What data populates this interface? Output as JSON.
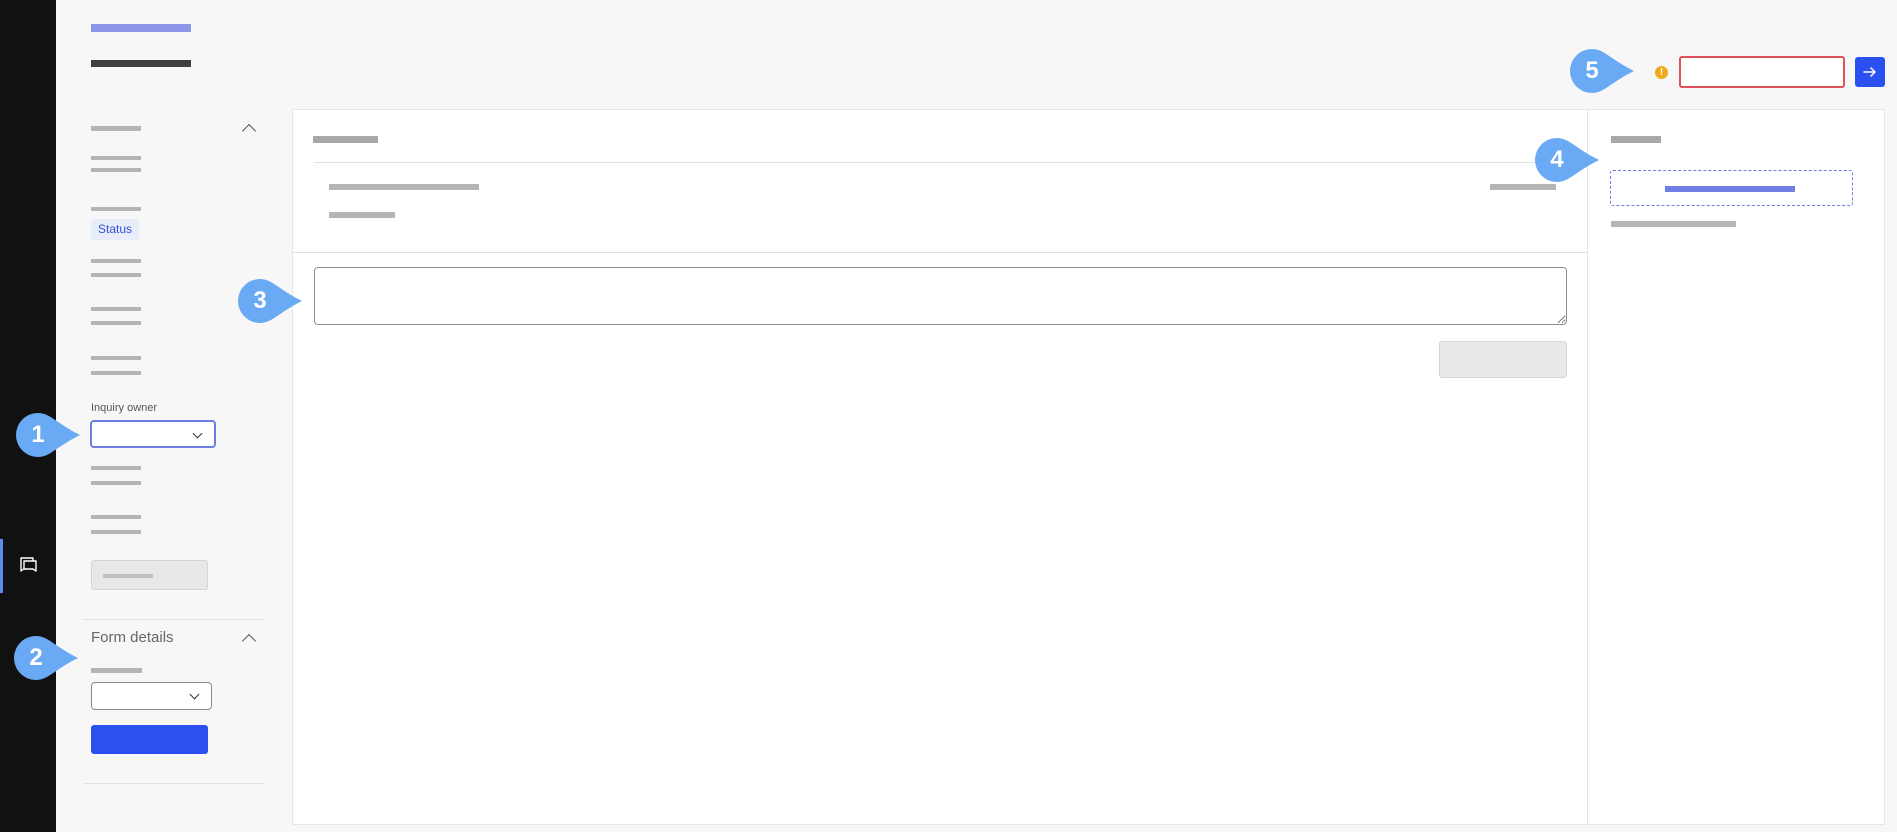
{
  "sidebar": {
    "status_tag": "Status",
    "inquiry_owner_label": "Inquiry owner",
    "form_details_title": "Form details"
  },
  "markers": {
    "m1": "1",
    "m2": "2",
    "m3": "3",
    "m4": "4",
    "m5": "5"
  },
  "top_bar": {
    "warning_symbol": "!"
  },
  "colors": {
    "primary": "#2a50f0",
    "marker": "#6aaaf5",
    "error": "#e0525b",
    "warning": "#f0a91b",
    "rail": "#111111"
  },
  "icons": {
    "rail": "chat-bubbles-icon",
    "go": "arrow-right-icon",
    "warning": "warning-icon"
  }
}
